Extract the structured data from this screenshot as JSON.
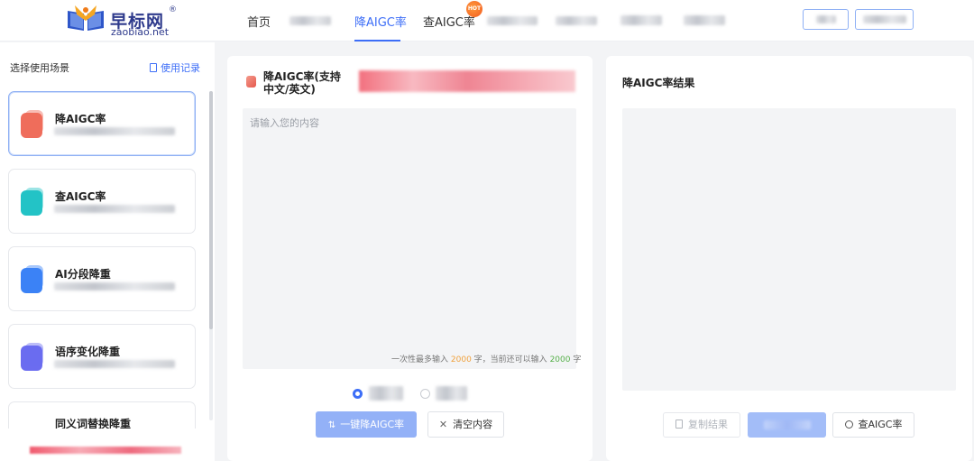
{
  "header": {
    "logo_cn": "早标网",
    "logo_reg": "®",
    "logo_en": "zaobiao.net",
    "nav": [
      {
        "label": "首页",
        "active": false
      },
      {
        "label": "降AIGC率",
        "active": true
      },
      {
        "label": "查AIGC率",
        "active": false,
        "badge": "HOT"
      }
    ]
  },
  "sidebar": {
    "title": "选择使用场景",
    "record_link": "使用记录",
    "items": [
      {
        "label": "降AIGC率",
        "icon": "doc-reduce-icon",
        "color": "#ef6d5c",
        "active": true
      },
      {
        "label": "查AIGC率",
        "icon": "doc-check-icon",
        "color": "#23c3c6",
        "active": false
      },
      {
        "label": "AI分段降重",
        "icon": "doc-paragraph-icon",
        "color": "#3b82f6",
        "active": false
      },
      {
        "label": "语序变化降重",
        "icon": "doc-reorder-icon",
        "color": "#6b6cf0",
        "active": false
      },
      {
        "label": "同义词替换降重",
        "icon": "doc-synonym-icon",
        "color": "#8a8ff0",
        "active": false
      }
    ]
  },
  "input_panel": {
    "title": "降AIGC率(支持中文/英文)",
    "placeholder": "请输入您的内容",
    "hint_prefix": "一次性最多输入",
    "hint_max": "2000",
    "hint_mid": "字，当前还可以输入",
    "hint_remaining": "2000",
    "hint_suffix": "字",
    "submit_label": "一键降AIGC率",
    "clear_label": "清空内容"
  },
  "result_panel": {
    "title": "降AIGC率结果",
    "copy_label": "复制结果",
    "check_label": "查AIGC率"
  },
  "colors": {
    "accent": "#3d6ef7",
    "primary_button": "#93b1f7"
  }
}
